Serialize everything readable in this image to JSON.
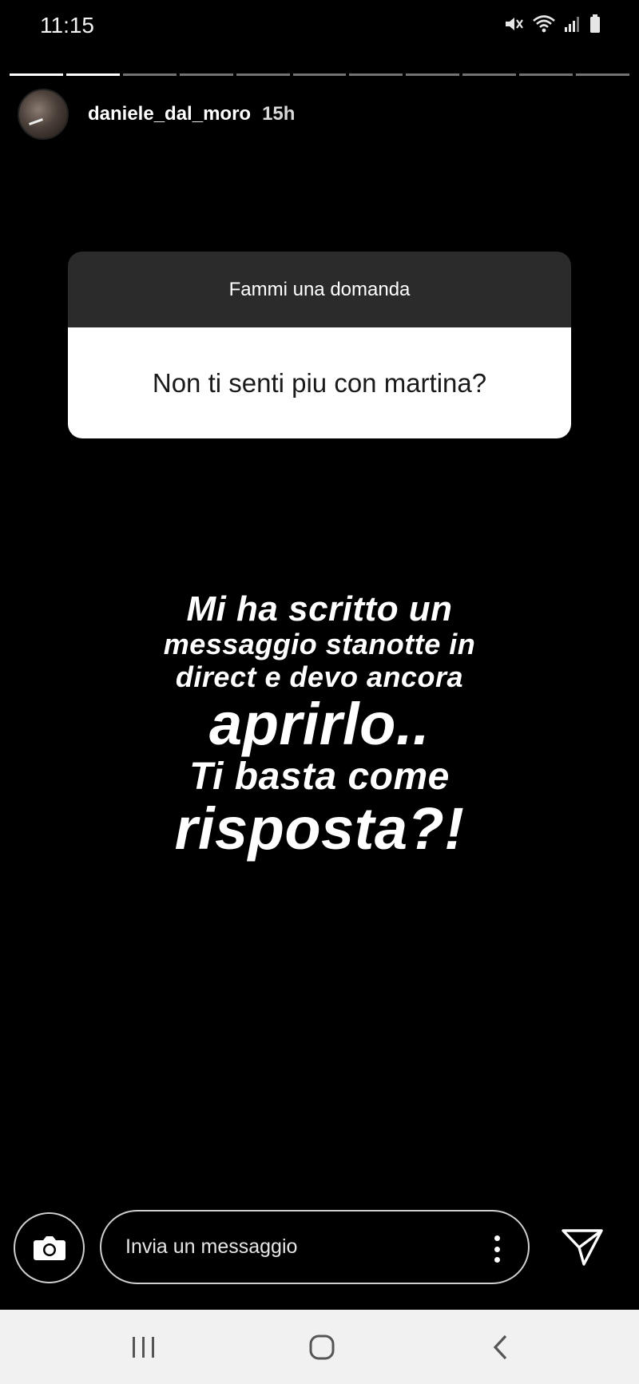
{
  "status_bar": {
    "time": "11:15",
    "icons": [
      "mute-icon",
      "wifi-icon",
      "signal-icon",
      "battery-icon"
    ]
  },
  "story": {
    "segments_total": 11,
    "segments_done": 2,
    "username": "daniele_dal_moro",
    "time_ago": "15h"
  },
  "question": {
    "header": "Fammi una domanda",
    "text": "Non ti senti piu con martina?"
  },
  "answer": {
    "line1": "Mi ha scritto un",
    "line2": "messaggio stanotte in",
    "line3": "direct e devo ancora",
    "line4": "aprirlo..",
    "line5": "Ti basta come",
    "line6": "risposta?!"
  },
  "reply_bar": {
    "placeholder": "Invia un messaggio",
    "camera_icon": "camera-icon",
    "more_icon": "more-vertical-icon",
    "send_icon": "send-icon"
  },
  "nav_bar": {
    "buttons": [
      "recent-apps-icon",
      "home-icon",
      "back-icon"
    ]
  },
  "colors": {
    "background": "#000000",
    "card_header": "#2b2b2b",
    "card_body": "#ffffff",
    "nav_bar": "#f1f1f1"
  }
}
